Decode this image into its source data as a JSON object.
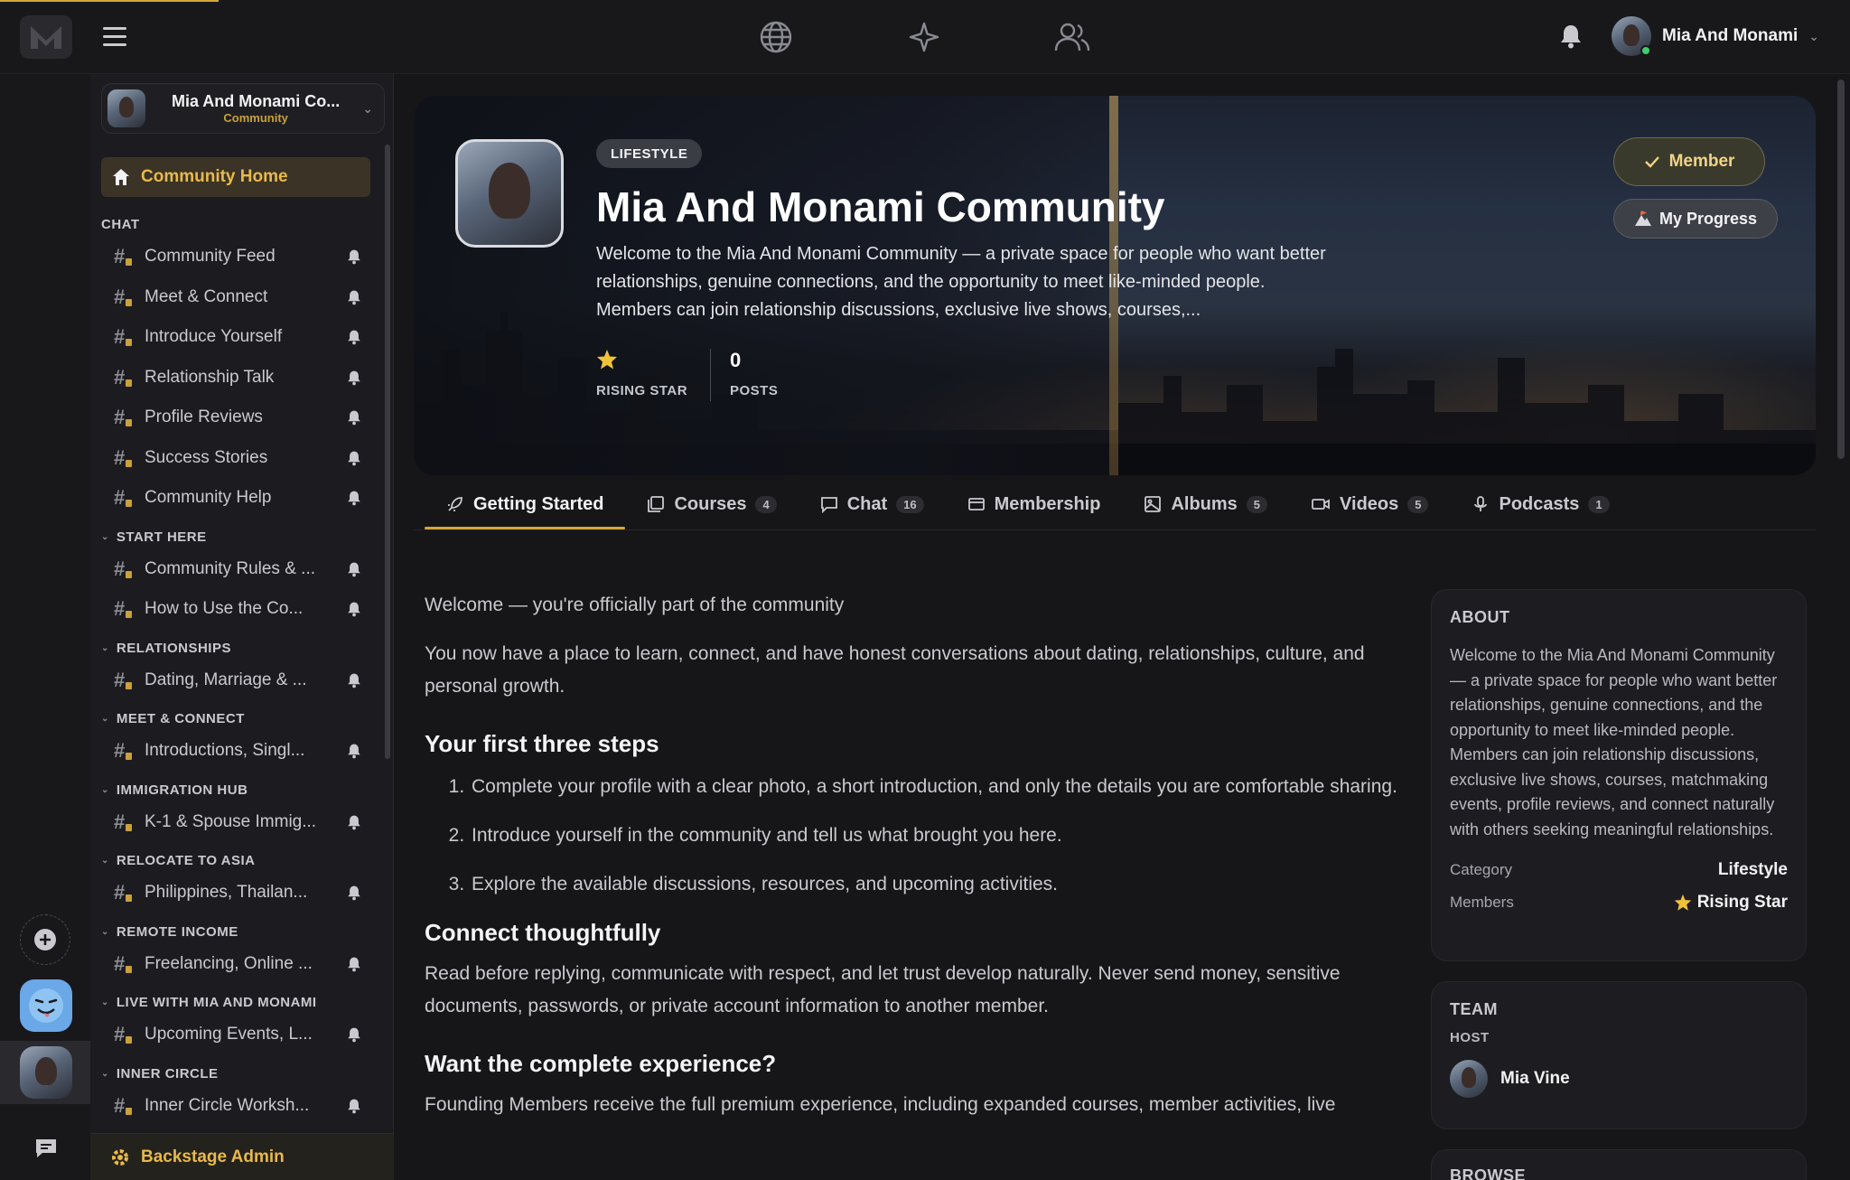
{
  "topbar": {
    "user_name": "Mia And Monami"
  },
  "community_switcher": {
    "name": "Mia And Monami Co...",
    "type": "Community"
  },
  "sidebar": {
    "home_label": "Community Home",
    "sections": [
      {
        "title": "CHAT",
        "collapsible": false,
        "channels": [
          "Community Feed",
          "Meet & Connect",
          "Introduce Yourself",
          "Relationship Talk",
          "Profile Reviews",
          "Success Stories",
          "Community Help"
        ]
      },
      {
        "title": "START HERE",
        "collapsible": true,
        "channels": [
          "Community Rules & ...",
          "How to Use the Co..."
        ]
      },
      {
        "title": "RELATIONSHIPS",
        "collapsible": true,
        "channels": [
          "Dating, Marriage & ..."
        ]
      },
      {
        "title": "MEET & CONNECT",
        "collapsible": true,
        "channels": [
          "Introductions, Singl..."
        ]
      },
      {
        "title": "IMMIGRATION HUB",
        "collapsible": true,
        "channels": [
          "K-1 & Spouse Immig..."
        ]
      },
      {
        "title": "RELOCATE TO ASIA",
        "collapsible": true,
        "channels": [
          "Philippines, Thailan..."
        ]
      },
      {
        "title": "REMOTE INCOME",
        "collapsible": true,
        "channels": [
          "Freelancing, Online ..."
        ]
      },
      {
        "title": "LIVE WITH MIA AND MONAMI",
        "collapsible": true,
        "channels": [
          "Upcoming Events, L..."
        ]
      },
      {
        "title": "INNER CIRCLE",
        "collapsible": true,
        "channels": [
          "Inner Circle Worksh..."
        ]
      }
    ],
    "admin_label": "Backstage Admin"
  },
  "hero": {
    "category_pill": "LIFESTYLE",
    "title": "Mia And Monami Community",
    "description": "Welcome to the Mia And Monami Community — a private space for people who want better relationships, genuine connections, and the opportunity to meet like-minded people. Members can join relationship discussions, exclusive live shows, courses,...",
    "stats": [
      {
        "value": "",
        "label": "RISING STAR",
        "icon": "star-icon"
      },
      {
        "value": "0",
        "label": "POSTS"
      }
    ],
    "member_button": "Member",
    "progress_button": "My Progress"
  },
  "tabs": [
    {
      "label": "Getting Started",
      "count": "",
      "icon": "rocket-icon",
      "active": true
    },
    {
      "label": "Courses",
      "count": "4",
      "icon": "courses-icon",
      "active": false
    },
    {
      "label": "Chat",
      "count": "16",
      "icon": "chat-icon",
      "active": false
    },
    {
      "label": "Membership",
      "count": "",
      "icon": "card-icon",
      "active": false
    },
    {
      "label": "Albums",
      "count": "5",
      "icon": "image-icon",
      "active": false
    },
    {
      "label": "Videos",
      "count": "5",
      "icon": "video-icon",
      "active": false
    },
    {
      "label": "Podcasts",
      "count": "1",
      "icon": "mic-icon",
      "active": false
    }
  ],
  "article": {
    "intro": "Welcome — you're officially part of the community",
    "para1": "You now have a place to learn, connect, and have honest conversations about dating, relationships, culture, and personal growth.",
    "h_steps": "Your first three steps",
    "steps": [
      "Complete your profile with a clear photo, a short introduction, and only the details you are comfortable sharing.",
      "Introduce yourself in the community and tell us what brought you here.",
      "Explore the available discussions, resources, and upcoming activities."
    ],
    "h_connect": "Connect thoughtfully",
    "para_connect": "Read before replying, communicate with respect, and let trust develop naturally. Never send money, sensitive documents, passwords, or private account information to another member.",
    "h_experience": "Want the complete experience?",
    "para_experience": "Founding Members receive the full premium experience, including expanded courses, member activities, live"
  },
  "about": {
    "title": "ABOUT",
    "text": "Welcome to the Mia And Monami Community — a private space for people who want better relationships, genuine connections, and the opportunity to meet like-minded people. Members can join relationship discussions, exclusive live shows, courses, matchmaking events, profile reviews, and connect naturally with others seeking meaningful relationships.",
    "category_label": "Category",
    "category_value": "Lifestyle",
    "members_label": "Members",
    "members_value": "Rising Star"
  },
  "team": {
    "title": "TEAM",
    "host_label": "HOST",
    "host_name": "Mia Vine"
  },
  "browse": {
    "title": "BROWSE"
  },
  "colors": {
    "accent_gold": "#d4a836",
    "background": "#161619",
    "panel": "#1d1d21"
  }
}
